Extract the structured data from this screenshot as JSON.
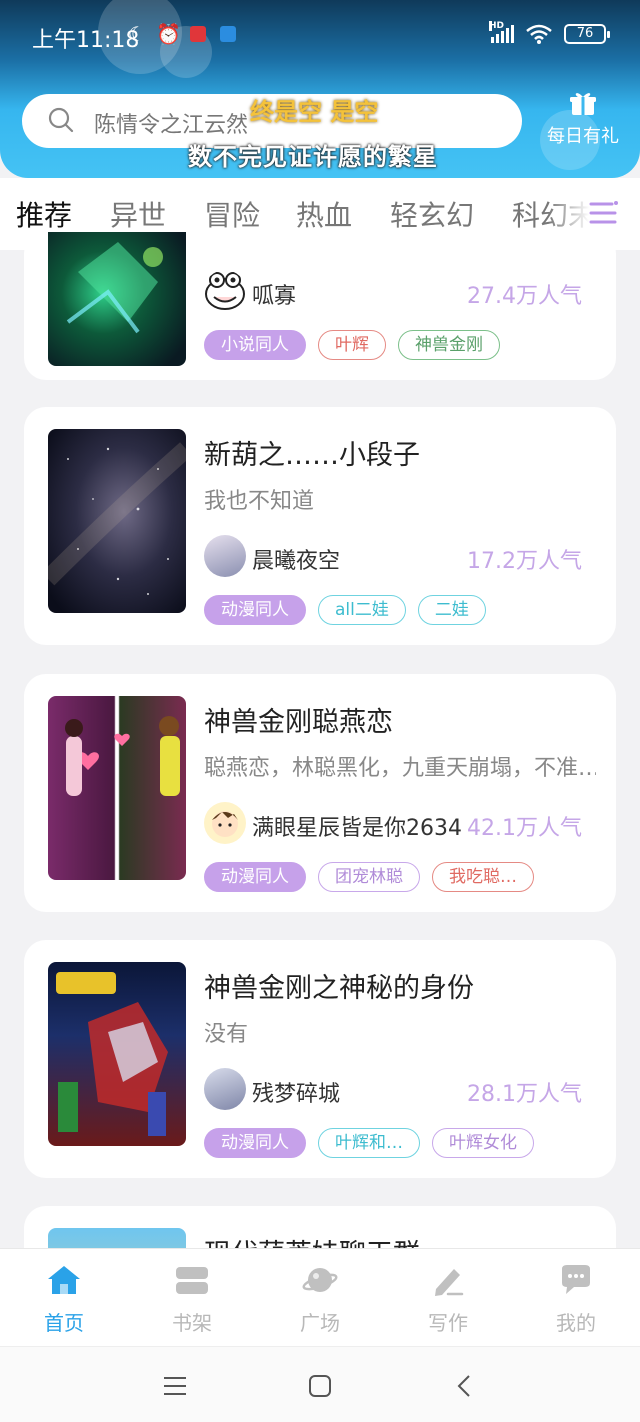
{
  "status_bar": {
    "time": "上午11:18",
    "battery": "76",
    "hd": "HD"
  },
  "header": {
    "search_text": "陈情令之江云然",
    "overlay_line1": "终是空 是空",
    "overlay_line2": "数不完见证许愿的繁星",
    "gift_label": "每日有礼"
  },
  "tabs": [
    {
      "label": "推荐",
      "active": true
    },
    {
      "label": "异世"
    },
    {
      "label": "冒险"
    },
    {
      "label": "热血"
    },
    {
      "label": "轻玄幻"
    },
    {
      "label": "科幻末"
    }
  ],
  "cards": [
    {
      "title": "",
      "desc": "",
      "author": "呱寡",
      "popularity": "27.4万人气",
      "tags": [
        {
          "label": "小说同人",
          "style": "fill"
        },
        {
          "label": "叶辉",
          "style": "red"
        },
        {
          "label": "神兽金刚",
          "style": "green"
        }
      ]
    },
    {
      "title": "新葫之……小段子",
      "desc": "我也不知道",
      "author": "晨曦夜空",
      "popularity": "17.2万人气",
      "tags": [
        {
          "label": "动漫同人",
          "style": "fill"
        },
        {
          "label": "all二娃",
          "style": "cyan"
        },
        {
          "label": "二娃",
          "style": "cyan"
        }
      ]
    },
    {
      "title": "神兽金刚聪燕恋",
      "desc": "聪燕恋，林聪黑化，九重天崩塌，不准…",
      "author": "满眼星辰皆是你2634",
      "popularity": "42.1万人气",
      "tags": [
        {
          "label": "动漫同人",
          "style": "fill"
        },
        {
          "label": "团宠林聪",
          "style": "lav"
        },
        {
          "label": "我吃聪…",
          "style": "red"
        }
      ]
    },
    {
      "title": "神兽金刚之神秘的身份",
      "desc": "没有",
      "author": "残梦碎城",
      "popularity": "28.1万人气",
      "tags": [
        {
          "label": "动漫同人",
          "style": "fill"
        },
        {
          "label": "叶辉和…",
          "style": "cyan"
        },
        {
          "label": "叶辉女化",
          "style": "lav"
        }
      ]
    },
    {
      "title": "现代葫芦娃聊天群",
      "desc": "",
      "author": "",
      "popularity": "",
      "tags": []
    }
  ],
  "bottom_nav": [
    {
      "label": "首页",
      "icon": "home-icon",
      "active": true
    },
    {
      "label": "书架",
      "icon": "bookshelf-icon"
    },
    {
      "label": "广场",
      "icon": "planet-icon"
    },
    {
      "label": "写作",
      "icon": "pen-icon"
    },
    {
      "label": "我的",
      "icon": "chat-bubble-icon"
    }
  ],
  "colors": {
    "accent_purple": "#c6a1ea",
    "header_blue": "#36b6ef",
    "nav_active": "#2aa2e8"
  }
}
